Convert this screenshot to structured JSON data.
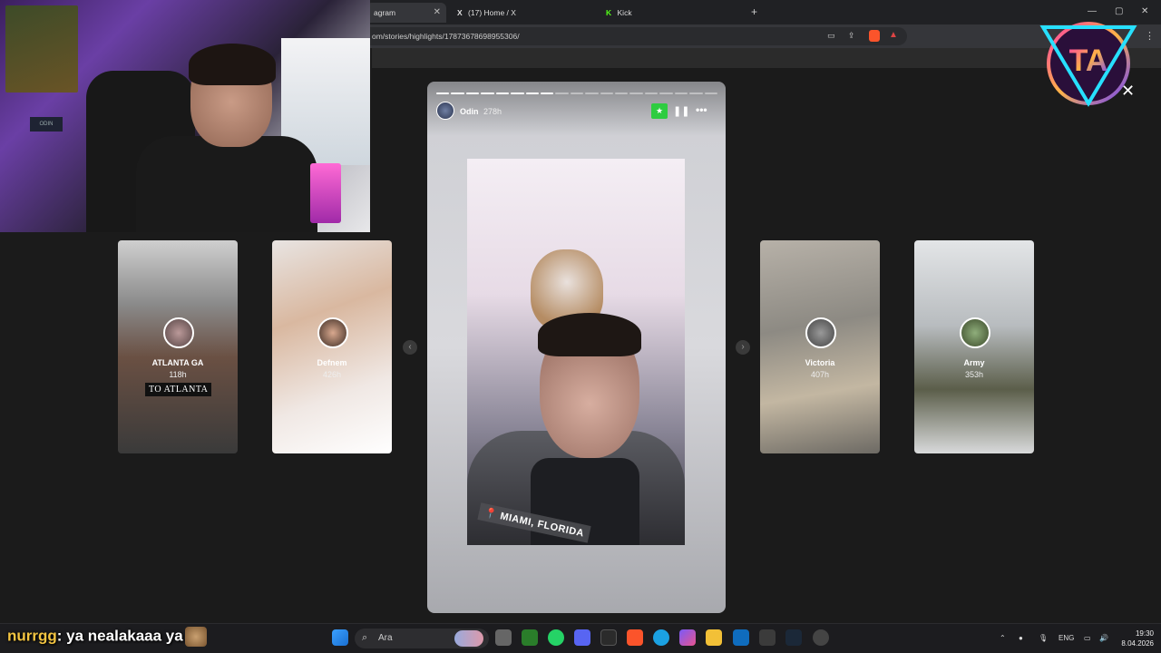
{
  "browser": {
    "tabs": [
      {
        "label": "agram",
        "active": true
      },
      {
        "label": "(17) Home / X",
        "active": false
      },
      {
        "label": "Kick",
        "active": false
      }
    ],
    "new_tab": "+",
    "url": "om/stories/highlights/17873678698955306/",
    "window_controls": [
      "—",
      "▢",
      "✕"
    ],
    "menu": "⋮"
  },
  "webcam": {
    "sign": "ODIN"
  },
  "story": {
    "username": "Odin",
    "time": "278h",
    "location": "📍 MIAMI, FLORIDA",
    "progress": {
      "segments": 19,
      "watched": 8
    },
    "star_icon": "★",
    "pause_icon": "❚❚",
    "more_icon": "•••"
  },
  "highlights": {
    "left": [
      {
        "name": "ATLANTA GA",
        "age": "118h",
        "caption": "TO ATLANTA"
      },
      {
        "name": "Defnem",
        "age": "426h"
      }
    ],
    "right": [
      {
        "name": "Victoria",
        "age": "407h"
      },
      {
        "name": "Army",
        "age": "353h"
      }
    ],
    "prev_arrow": "‹",
    "next_arrow": "›"
  },
  "overlay": {
    "close": "✕",
    "logo_text": "TA"
  },
  "chat": {
    "user": "nurrgg",
    "message": ": ya nealakaaa ya"
  },
  "taskbar": {
    "search_placeholder": "Ara",
    "language": "ENG",
    "time": "19:30",
    "date": "8.04.2026"
  }
}
